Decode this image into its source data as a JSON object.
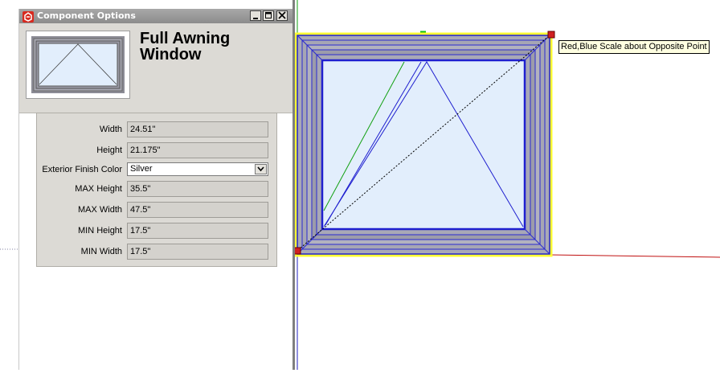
{
  "dialog": {
    "title": "Component Options",
    "icon": "sketchup-icon",
    "controls": [
      "minimize-icon",
      "maximize-icon",
      "close-icon"
    ]
  },
  "component": {
    "name": "Full Awning Window"
  },
  "options": [
    {
      "label": "Width",
      "value": "24.51\"",
      "type": "text"
    },
    {
      "label": "Height",
      "value": "21.175\"",
      "type": "text"
    },
    {
      "label": "Exterior Finish Color",
      "value": "Silver",
      "type": "select"
    },
    {
      "label": "MAX Height",
      "value": "35.5\"",
      "type": "text"
    },
    {
      "label": "MAX Width",
      "value": "47.5\"",
      "type": "text"
    },
    {
      "label": "MIN Height",
      "value": "17.5\"",
      "type": "text"
    },
    {
      "label": "MIN Width",
      "value": "17.5\"",
      "type": "text"
    }
  ],
  "viewport": {
    "tooltip": "Red,Blue Scale about Opposite Point",
    "colors": {
      "selection": "#ffff33",
      "glass": "#e2eefc",
      "frame": "#a9a9b6",
      "edge_selected": "#1f1fcf",
      "red_axis": "#c01010",
      "green_axis": "#10a010",
      "grip": "#d02020"
    }
  }
}
